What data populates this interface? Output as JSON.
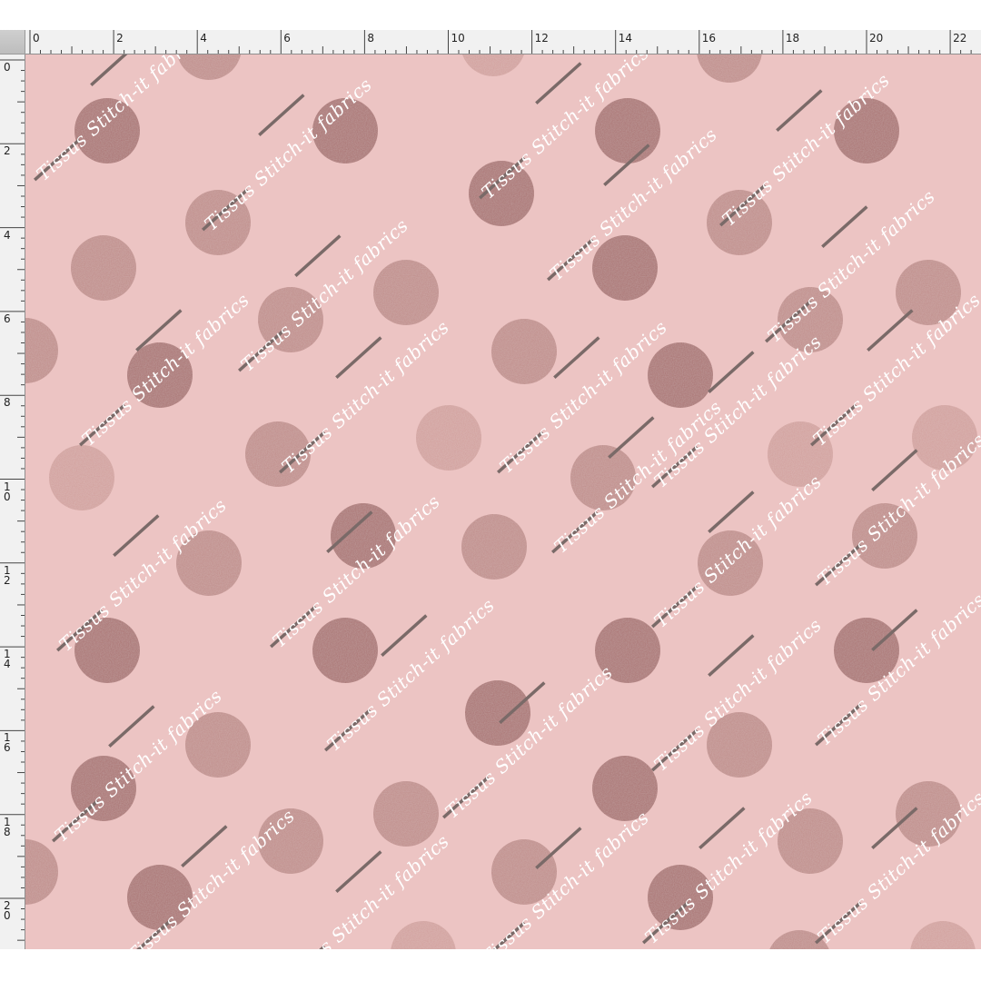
{
  "ruler": {
    "top_labels": [
      "0",
      "2",
      "4",
      "6",
      "8",
      "10",
      "12",
      "14",
      "16",
      "18",
      "20",
      "22"
    ],
    "left_labels": [
      "0",
      "2",
      "4",
      "6",
      "8",
      "10",
      "12",
      "14",
      "16",
      "18",
      "20"
    ]
  },
  "canvas": {
    "background_color": "#ecc4c3",
    "dot_colors": [
      "#a9716f",
      "#bf8b88",
      "#d19f9b"
    ],
    "watermark": {
      "text": "Tissus Stitch-it fabrics",
      "color": "#ffffff",
      "line_color": "#7a6a68"
    }
  }
}
